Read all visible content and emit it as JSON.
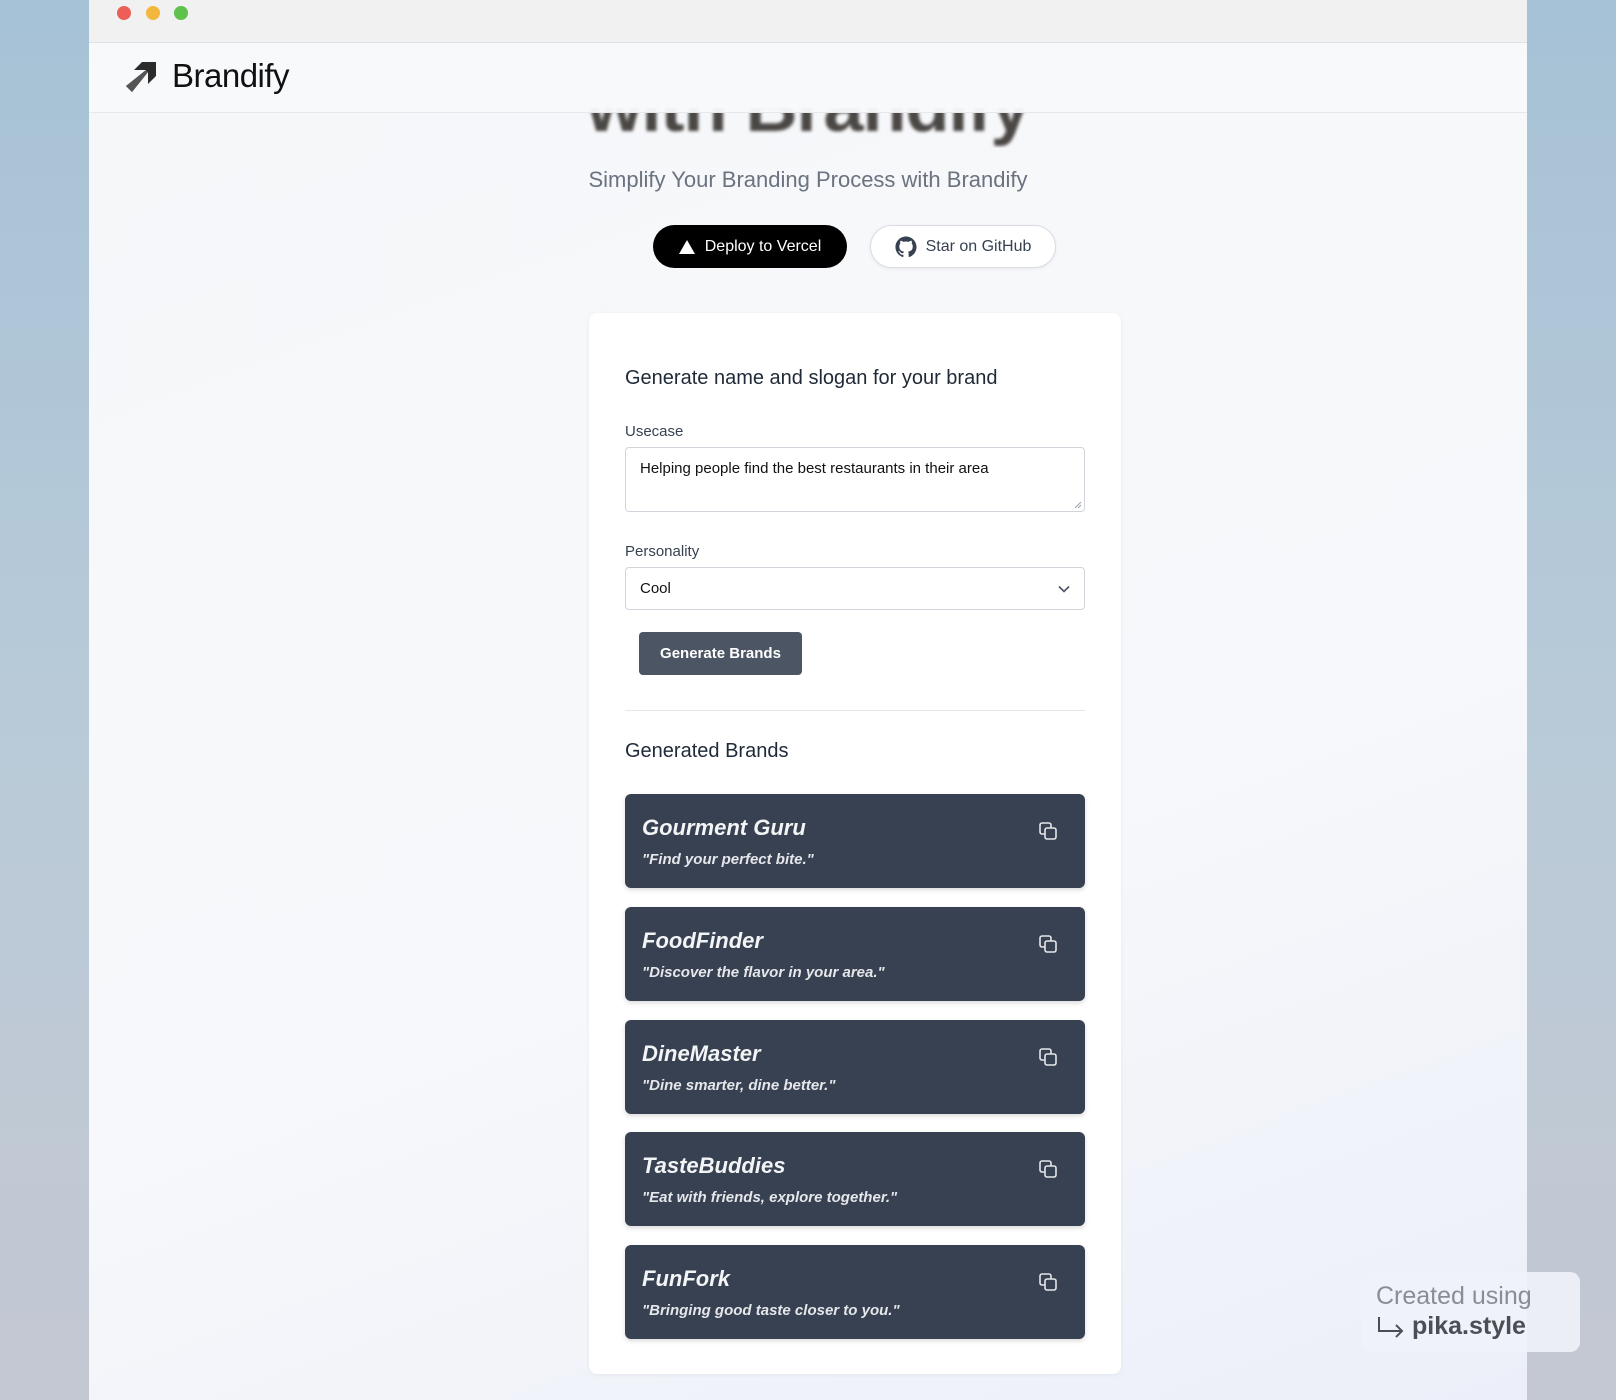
{
  "window": {
    "controls": [
      "close",
      "minimize",
      "maximize"
    ]
  },
  "navbar": {
    "logo_text": "Brandify",
    "logo_icon": "arrow-up-right-icon"
  },
  "hero": {
    "title_partial": "with Brandify",
    "subtitle": "Simplify Your Branding Process with Brandify",
    "deploy_label": "Deploy to Vercel",
    "github_label": "Star on GitHub"
  },
  "form": {
    "heading": "Generate name and slogan for your brand",
    "usecase_label": "Usecase",
    "usecase_value": "Helping people find the best restaurants in their area",
    "personality_label": "Personality",
    "personality_value": "Cool",
    "generate_label": "Generate Brands"
  },
  "results": {
    "heading": "Generated Brands",
    "brands": [
      {
        "name": "Gourment Guru",
        "slogan": "\"Find your perfect bite.\""
      },
      {
        "name": "FoodFinder",
        "slogan": "\"Discover the flavor in your area.\""
      },
      {
        "name": "DineMaster",
        "slogan": "\"Dine smarter, dine better.\""
      },
      {
        "name": "TasteBuddies",
        "slogan": "\"Eat with friends, explore together.\""
      },
      {
        "name": "FunFork",
        "slogan": "\"Bringing good taste closer to you.\""
      }
    ]
  },
  "watermark": {
    "line1": "Created using",
    "line2": "pika.style"
  },
  "colors": {
    "brand_card_bg": "#374151",
    "generate_button_bg": "#4b5563",
    "deploy_button_bg": "#000000"
  }
}
